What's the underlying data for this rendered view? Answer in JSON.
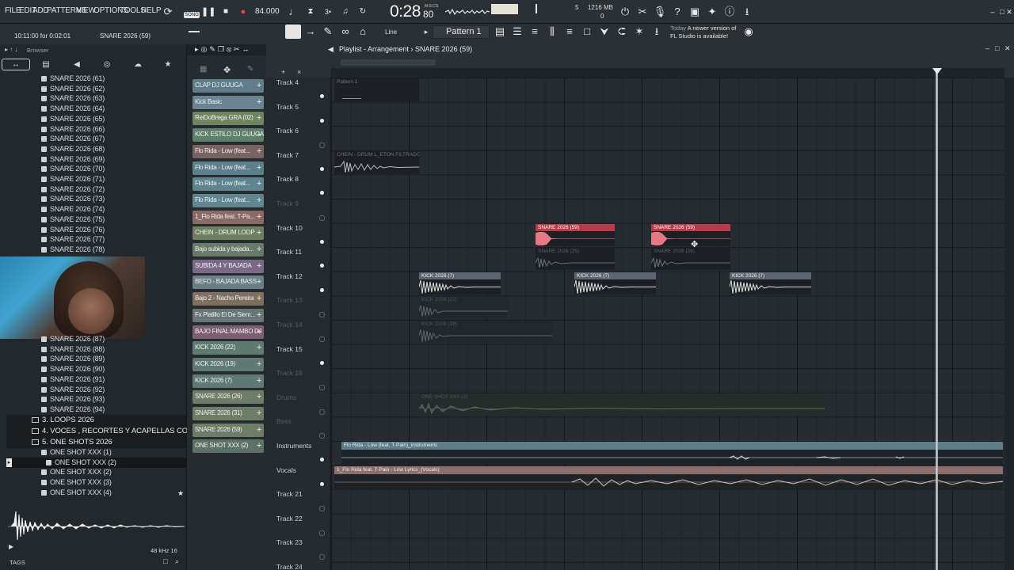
{
  "menu": {
    "items": [
      "FILE",
      "EDIT",
      "ADD",
      "PATTERNS",
      "VIEW",
      "OPTIONS",
      "TOOLS",
      "HELP"
    ]
  },
  "transport": {
    "mode": "SONG",
    "tempo": "84.000",
    "time": "0:28",
    "time_ms": "80",
    "time_unit": "M:S:CS",
    "cpu": "1216 MB",
    "poly": "5",
    "cpu2": "0"
  },
  "hint": {
    "time": "10:11:00 for 0:02:01",
    "name": "SNARE 2026 (59)"
  },
  "toolbar2": {
    "line_label": "Line",
    "pattern": "Pattern 1",
    "news_day": "Today",
    "news_text": "A newer version of",
    "news_text2": "FL Studio is available!"
  },
  "browser": {
    "title": "Browser",
    "snares": [
      "SNARE 2026 (61)",
      "SNARE 2026 (62)",
      "SNARE 2026 (63)",
      "SNARE 2026 (64)",
      "SNARE 2026 (65)",
      "SNARE 2026 (66)",
      "SNARE 2026 (67)",
      "SNARE 2026 (68)",
      "SNARE 2026 (69)",
      "SNARE 2026 (70)",
      "SNARE 2026 (71)",
      "SNARE 2026 (72)",
      "SNARE 2026 (73)",
      "SNARE 2026 (74)",
      "SNARE 2026 (75)",
      "SNARE 2026 (76)",
      "SNARE 2026 (77)",
      "SNARE 2026 (78)"
    ],
    "snares_lower": [
      "SNARE 2026 (87)",
      "SNARE 2026 (88)",
      "SNARE 2026 (89)",
      "SNARE 2026 (90)",
      "SNARE 2026 (91)",
      "SNARE 2026 (92)",
      "SNARE 2026 (93)",
      "SNARE 2026 (94)"
    ],
    "folders": [
      "3. LOOPS 2026",
      "4. VOCES , RECORTES Y ACAPELLAS COMPLETAS",
      "5. ONE SHOTS 2026"
    ],
    "oneshots": [
      "ONE SHOT XXX (1)",
      "ONE SHOT XXX (2)",
      "ONE SHOT XXX (2)",
      "ONE SHOT XXX (3)",
      "ONE SHOT XXX (4)"
    ],
    "sample_rate": "48 kHz 16",
    "tags": "TAGS"
  },
  "picker": [
    {
      "label": "CLAP DJ GUUGA",
      "color": "#5f7e8c"
    },
    {
      "label": "Kick Basic",
      "color": "#6c8492"
    },
    {
      "label": "ReiDoBrega GRA (02)",
      "color": "#6f8460"
    },
    {
      "label": "KICK ESTILO DJ GUUGA",
      "color": "#5f806a"
    },
    {
      "label": "Flo Rida - Low (feat...",
      "color": "#7a6262"
    },
    {
      "label": "Flo Rida - Low (feat...",
      "color": "#5c7f8c"
    },
    {
      "label": "Flo Rida - Low (feat...",
      "color": "#5f8590"
    },
    {
      "label": "Flo Rida - Low (feat...",
      "color": "#5f8590"
    },
    {
      "label": "1_Flo Rida feat. T-Pa...",
      "color": "#8a6a66"
    },
    {
      "label": "CHEIN - DRUM LOOP",
      "color": "#6f8060"
    },
    {
      "label": "Bajo subida y bajada...",
      "color": "#6a7a6a"
    },
    {
      "label": "SUBIDA 4 Y BAJADA",
      "color": "#7a6a86"
    },
    {
      "label": "BEFO - BAJADA BASS",
      "color": "#6a7f86"
    },
    {
      "label": "Bajo 2 - Nacho Pereira",
      "color": "#7f6f5f"
    },
    {
      "label": "Fx Platillo El De Siem...",
      "color": "#6a7676"
    },
    {
      "label": "BAJO FINAL MAMBO DJ",
      "color": "#7e5e72"
    },
    {
      "label": "KICK 2026 (22)",
      "color": "#5f7a70"
    },
    {
      "label": "KICK 2026 (19)",
      "color": "#5f7a74"
    },
    {
      "label": "KICK 2026 (7)",
      "color": "#5f7a74"
    },
    {
      "label": "SNARE 2026 (26)",
      "color": "#6f7c66"
    },
    {
      "label": "SNARE 2026 (31)",
      "color": "#6f7c66"
    },
    {
      "label": "SNARE 2026 (59)",
      "color": "#6f7c66"
    },
    {
      "label": "ONE SHOT XXX (2)",
      "color": "#5c7268"
    }
  ],
  "playlist": {
    "title": "Playlist - Arrangement",
    "current": "SNARE 2026 (59)",
    "tracks": [
      "Track 4",
      "Track 5",
      "Track 6",
      "Track 7",
      "Track 8",
      "Track 9",
      "Track 10",
      "Track 11",
      "Track 12",
      "Track 13",
      "Track 14",
      "Track 15",
      "Track 16",
      "Drums",
      "Bass",
      "Instruments",
      "Vocals",
      "Track 21",
      "Track 22",
      "Track 23",
      "Track 24"
    ],
    "clips": {
      "pattern1": "Pattern 1",
      "chein": "CHEIN - DRUM L_ETON FILTRADO",
      "snare59": "SNARE 2026 (59)",
      "snare26": "SNARE 2026 (26)",
      "kick7": "KICK 2026 (7)",
      "kick22": "KICK 2026 (22)",
      "kick19": "KICK 2026 (19)",
      "oneshot": "ONE SHOT XXX (2)",
      "instruments": "Flo Rida - Low (feat. T-Pain)_instruments",
      "vocals": "1_Flo Rida feat. T-Pain - Low  Lyrics_(Vocals)"
    }
  }
}
